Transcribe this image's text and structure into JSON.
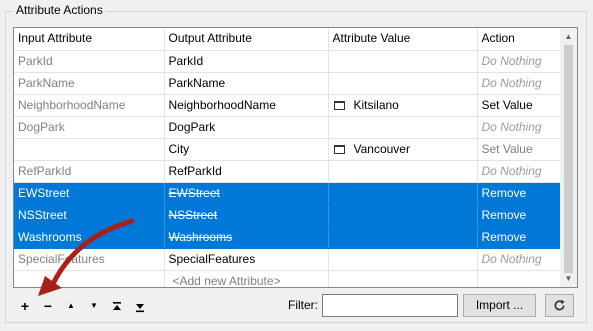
{
  "group_title": "Attribute Actions",
  "columns": [
    "Input Attribute",
    "Output Attribute",
    "Attribute Value",
    "Action"
  ],
  "rows": [
    {
      "input": "ParkId",
      "output": "ParkId",
      "value": "",
      "action": "Do Nothing",
      "selected": false,
      "has_check": false
    },
    {
      "input": "ParkName",
      "output": "ParkName",
      "value": "",
      "action": "Do Nothing",
      "selected": false,
      "has_check": false
    },
    {
      "input": "NeighborhoodName",
      "output": "NeighborhoodName",
      "value": "Kitsilano",
      "action": "Set Value",
      "selected": false,
      "has_check": true
    },
    {
      "input": "DogPark",
      "output": "DogPark",
      "value": "",
      "action": "Do Nothing",
      "selected": false,
      "has_check": false
    },
    {
      "input": "",
      "output": "City",
      "value": "Vancouver",
      "action": "Set Value",
      "selected": false,
      "has_check": true
    },
    {
      "input": "RefParkId",
      "output": "RefParkId",
      "value": "",
      "action": "Do Nothing",
      "selected": false,
      "has_check": false
    },
    {
      "input": "EWStreet",
      "output": "EWStreet",
      "value": "",
      "action": "Remove",
      "selected": true,
      "has_check": false
    },
    {
      "input": "NSStreet",
      "output": "NSStreet",
      "value": "",
      "action": "Remove",
      "selected": true,
      "has_check": false
    },
    {
      "input": "Washrooms",
      "output": "Washrooms",
      "value": "",
      "action": "Remove",
      "selected": true,
      "has_check": false
    },
    {
      "input": "SpecialFeatures",
      "output": "SpecialFeatures",
      "value": "",
      "action": "Do Nothing",
      "selected": false,
      "has_check": false
    }
  ],
  "add_row_label": "<Add new Attribute>",
  "toolbar": {
    "add": "+",
    "remove": "−",
    "move_up": "▲",
    "move_down": "▼",
    "move_top_icon": "move-to-top-icon",
    "move_bottom_icon": "move-to-bottom-icon"
  },
  "filter": {
    "label": "Filter:",
    "value": "",
    "placeholder": ""
  },
  "import_label": "Import ...",
  "refresh_icon": "refresh-icon",
  "colors": {
    "selection": "#0078d7",
    "arrow": "#a8201a"
  }
}
